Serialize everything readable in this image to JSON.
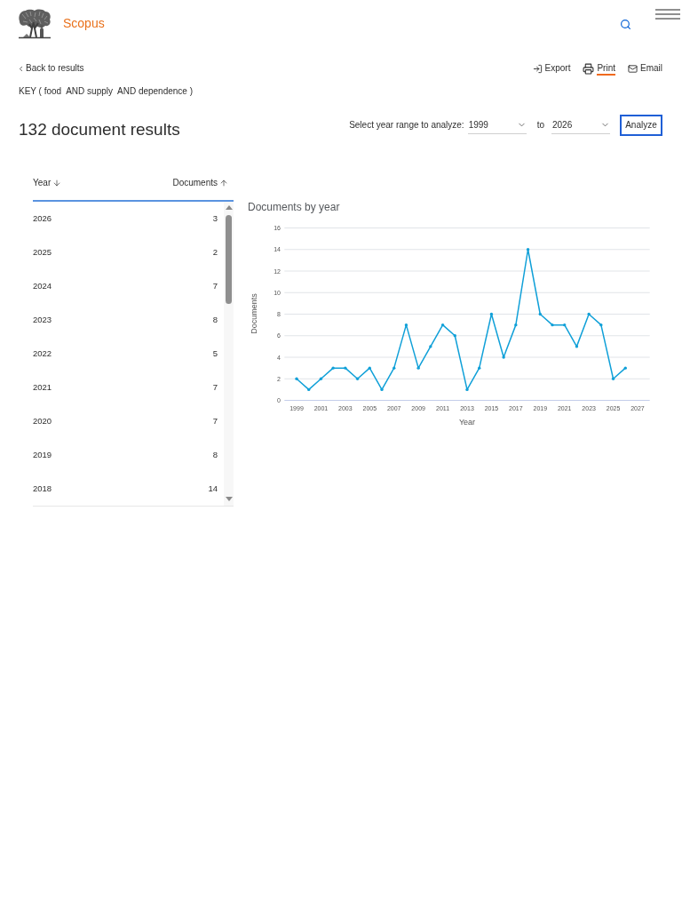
{
  "header": {
    "brand": "Scopus"
  },
  "toolbar": {
    "back_link": "Back to results",
    "actions": [
      {
        "label": "Export",
        "kind": "export",
        "selected": false
      },
      {
        "label": "Print",
        "kind": "print",
        "selected": true
      },
      {
        "label": "Email",
        "kind": "email",
        "selected": false
      }
    ]
  },
  "query": "KEY ( food  AND supply  AND dependence )",
  "results_title": "132 document results",
  "year_range": {
    "label": "Select year range to analyze:",
    "from": "1999",
    "separator": "to",
    "to": "2026",
    "button": "Analyze"
  },
  "table": {
    "columns": [
      {
        "label": "Year",
        "sort_ascending": false
      },
      {
        "label": "Documents",
        "sort_ascending": true
      }
    ],
    "rows": [
      {
        "year": "2026",
        "documents": "3"
      },
      {
        "year": "2025",
        "documents": "2"
      },
      {
        "year": "2024",
        "documents": "7"
      },
      {
        "year": "2023",
        "documents": "8"
      },
      {
        "year": "2022",
        "documents": "5"
      },
      {
        "year": "2021",
        "documents": "7"
      },
      {
        "year": "2020",
        "documents": "7"
      },
      {
        "year": "2019",
        "documents": "8"
      },
      {
        "year": "2018",
        "documents": "14"
      }
    ]
  },
  "chart": {
    "chart_data": {
      "type": "line",
      "title": "Documents by year",
      "xlabel": "Year",
      "ylabel": "Documents",
      "x": [
        1999,
        2000,
        2001,
        2002,
        2003,
        2004,
        2005,
        2006,
        2007,
        2008,
        2009,
        2010,
        2011,
        2012,
        2013,
        2014,
        2015,
        2016,
        2017,
        2018,
        2019,
        2020,
        2021,
        2022,
        2023,
        2024,
        2025,
        2026
      ],
      "series": [
        {
          "color": "#10a0d8",
          "values": [
            2,
            1,
            2,
            3,
            3,
            2,
            3,
            1,
            3,
            7,
            3,
            5,
            7,
            6,
            1,
            3,
            8,
            4,
            7,
            14,
            8,
            7,
            7,
            5,
            8,
            7,
            2,
            3
          ]
        }
      ],
      "xlim": [
        1998,
        2028
      ],
      "ylim": [
        0,
        16
      ],
      "xticks": [
        1999,
        2001,
        2003,
        2005,
        2007,
        2009,
        2011,
        2013,
        2015,
        2017,
        2019,
        2021,
        2023,
        2025,
        2027
      ],
      "yticks": [
        0,
        2,
        4,
        6,
        8,
        10,
        12,
        14,
        16
      ],
      "grid": true
    }
  }
}
